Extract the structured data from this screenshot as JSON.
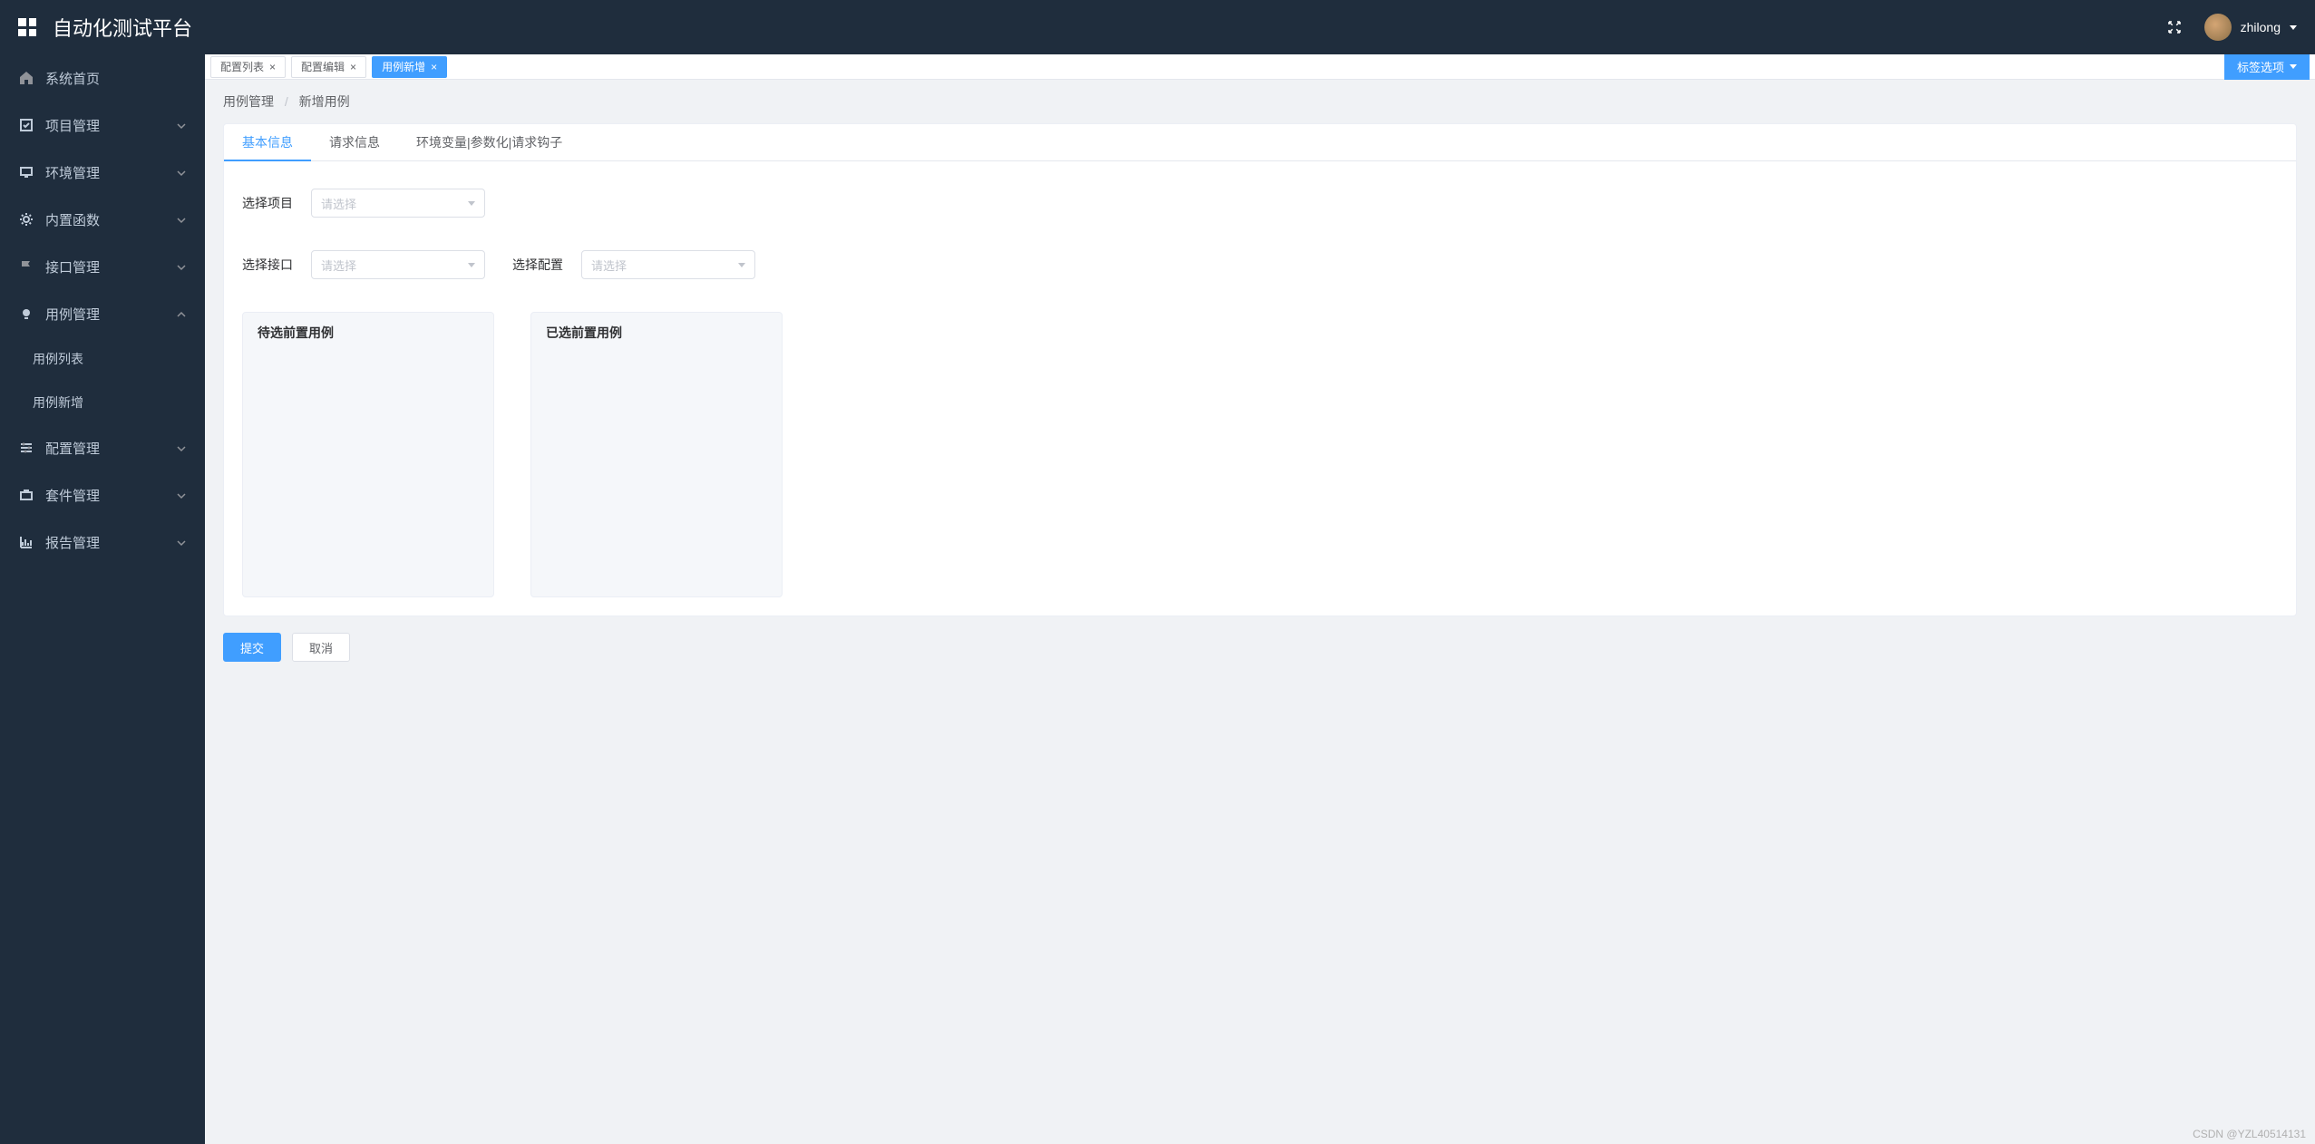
{
  "header": {
    "title": "自动化测试平台",
    "username": "zhilong"
  },
  "sidebar": [
    {
      "label": "系统首页",
      "expandable": false,
      "icon": "home"
    },
    {
      "label": "项目管理",
      "expandable": true,
      "icon": "check"
    },
    {
      "label": "环境管理",
      "expandable": true,
      "icon": "monitor"
    },
    {
      "label": "内置函数",
      "expandable": true,
      "icon": "gear"
    },
    {
      "label": "接口管理",
      "expandable": true,
      "icon": "flag"
    },
    {
      "label": "用例管理",
      "expandable": true,
      "expanded": true,
      "icon": "bulb",
      "children": [
        {
          "label": "用例列表"
        },
        {
          "label": "用例新增"
        }
      ]
    },
    {
      "label": "配置管理",
      "expandable": true,
      "icon": "sliders"
    },
    {
      "label": "套件管理",
      "expandable": true,
      "icon": "briefcase"
    },
    {
      "label": "报告管理",
      "expandable": true,
      "icon": "chart"
    }
  ],
  "tabs": [
    {
      "label": "配置列表",
      "active": false
    },
    {
      "label": "配置编辑",
      "active": false
    },
    {
      "label": "用例新增",
      "active": true
    }
  ],
  "tabs_options_label": "标签选项",
  "breadcrumb": {
    "first": "用例管理",
    "second": "新增用例"
  },
  "form_tabs": [
    {
      "label": "基本信息",
      "active": true
    },
    {
      "label": "请求信息",
      "active": false
    },
    {
      "label": "环境变量|参数化|请求钩子",
      "active": false
    }
  ],
  "form": {
    "project_label": "选择项目",
    "project_placeholder": "请选择",
    "api_label": "选择接口",
    "api_placeholder": "请选择",
    "config_label": "选择配置",
    "config_placeholder": "请选择"
  },
  "transfer": {
    "left_title": "待选前置用例",
    "right_title": "已选前置用例"
  },
  "actions": {
    "submit": "提交",
    "cancel": "取消"
  },
  "watermark": "CSDN @YZL40514131"
}
